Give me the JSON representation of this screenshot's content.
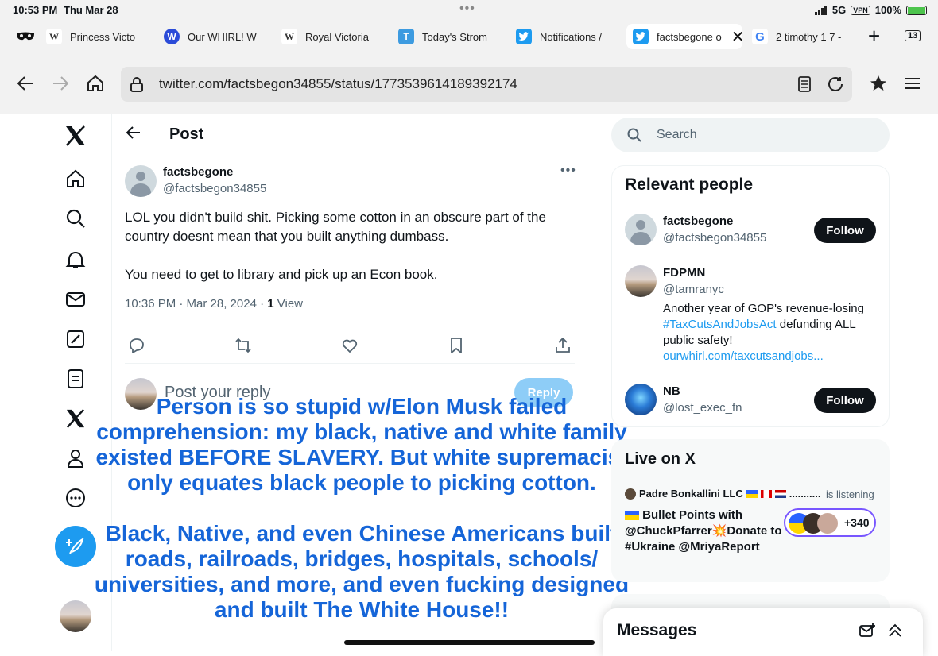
{
  "status_bar": {
    "time": "10:53 PM",
    "date": "Thu Mar 28",
    "signal": "5G",
    "vpn": "VPN",
    "battery": "100%"
  },
  "tabs": [
    {
      "label": "Princess Victo",
      "icon": "wikipedia-icon"
    },
    {
      "label": "Our WHIRL! W",
      "icon": "whirl-icon"
    },
    {
      "label": "Royal Victoria",
      "icon": "wikipedia-icon"
    },
    {
      "label": "Today's Strom",
      "icon": "t-icon"
    },
    {
      "label": "Notifications /",
      "icon": "twitter-icon"
    },
    {
      "label": "factsbegone o",
      "icon": "twitter-icon",
      "active": true
    },
    {
      "label": "2 timothy 1 7 -",
      "icon": "google-icon"
    }
  ],
  "tab_count": "13",
  "address_bar": {
    "url": "twitter.com/factsbegon34855/status/1773539614189392174"
  },
  "post": {
    "header_title": "Post",
    "author_name": "factsbegone",
    "author_handle": "@factsbegon34855",
    "body_line1": "LOL you didn't build shit. Picking some cotton in an obscure part of the country doesnt mean that you built anything dumbass.",
    "body_line2": "You need to get to library and pick up an Econ book.",
    "timestamp": "10:36 PM · Mar 28, 2024 · ",
    "view_count": "1",
    "view_label": " View",
    "reply_placeholder": "Post your reply",
    "reply_button": "Reply"
  },
  "overlay_caption": {
    "paragraph1": "Person is so stupid w/Elon Musk failed comprehension: my black, native and white family existed BEFORE SLAVERY. But white supremacist only equates black people to picking cotton.",
    "paragraph2": "Black, Native, and even Chinese Americans built roads, railroads, bridges, hospitals, schools/ universities, and more, and even fucking designed and built The White House!!",
    "color": "#1565d8"
  },
  "search": {
    "placeholder": "Search"
  },
  "relevant_people": {
    "title": "Relevant people",
    "people": [
      {
        "name": "factsbegone",
        "handle": "@factsbegon34855",
        "button": "Follow"
      },
      {
        "name": "FDPMN",
        "handle": "@tamranyc",
        "bio_text1": "Another year of GOP's revenue-losing ",
        "bio_hashtag": "#TaxCutsAndJobsAct",
        "bio_text2": " defunding ALL public safety!",
        "bio_link": "ourwhirl.com/taxcutsandjobs..."
      },
      {
        "name": "NB",
        "handle": "@lost_exec_fn",
        "button": "Follow"
      }
    ]
  },
  "live": {
    "title": "Live on X",
    "host": "Padre Bonkallini LLC",
    "host_suffix": "...........",
    "status": "is listening",
    "space_title": "Bullet Points with @ChuckPfarrer💥Donate to #Ukraine @MriyaReport",
    "listener_count": "+340"
  },
  "messages": {
    "title": "Messages"
  },
  "colors": {
    "accent": "#1d9bf0",
    "text": "#0f1419",
    "muted": "#536471"
  }
}
